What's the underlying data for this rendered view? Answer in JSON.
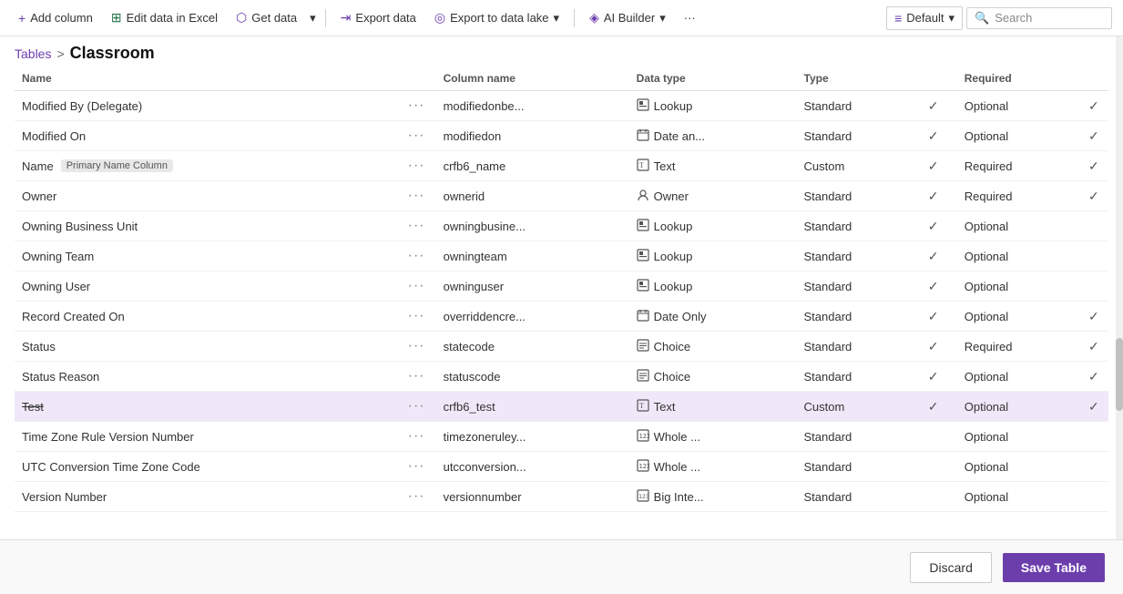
{
  "toolbar": {
    "add_column_label": "Add column",
    "edit_excel_label": "Edit data in Excel",
    "get_data_label": "Get data",
    "export_data_label": "Export data",
    "export_lake_label": "Export to data lake",
    "ai_builder_label": "AI Builder",
    "more_label": "···",
    "default_label": "Default",
    "search_label": "Search"
  },
  "breadcrumb": {
    "parent": "Tables",
    "separator": ">",
    "current": "Classroom"
  },
  "table": {
    "columns": [
      "Name",
      "",
      "Column name",
      "Data type",
      "Type",
      "",
      "Required",
      ""
    ],
    "rows": [
      {
        "name": "Modified By (Delegate)",
        "badge": null,
        "colname": "modifiedonbe...",
        "datatype_icon": "lookup",
        "datatype": "Lookup",
        "coltype": "Standard",
        "searchable": true,
        "required": "Optional",
        "checked": true,
        "strikethrough": false,
        "selected": false
      },
      {
        "name": "Modified On",
        "badge": null,
        "colname": "modifiedon",
        "datatype_icon": "date",
        "datatype": "Date an...",
        "coltype": "Standard",
        "searchable": true,
        "required": "Optional",
        "checked": true,
        "strikethrough": false,
        "selected": false
      },
      {
        "name": "Name",
        "badge": "Primary Name Column",
        "colname": "crfb6_name",
        "datatype_icon": "text",
        "datatype": "Text",
        "coltype": "Custom",
        "searchable": true,
        "required": "Required",
        "checked": true,
        "strikethrough": false,
        "selected": false
      },
      {
        "name": "Owner",
        "badge": null,
        "colname": "ownerid",
        "datatype_icon": "owner",
        "datatype": "Owner",
        "coltype": "Standard",
        "searchable": true,
        "required": "Required",
        "checked": true,
        "strikethrough": false,
        "selected": false
      },
      {
        "name": "Owning Business Unit",
        "badge": null,
        "colname": "owningbusine...",
        "datatype_icon": "lookup",
        "datatype": "Lookup",
        "coltype": "Standard",
        "searchable": true,
        "required": "Optional",
        "checked": false,
        "strikethrough": false,
        "selected": false
      },
      {
        "name": "Owning Team",
        "badge": null,
        "colname": "owningteam",
        "datatype_icon": "lookup",
        "datatype": "Lookup",
        "coltype": "Standard",
        "searchable": true,
        "required": "Optional",
        "checked": false,
        "strikethrough": false,
        "selected": false
      },
      {
        "name": "Owning User",
        "badge": null,
        "colname": "owninguser",
        "datatype_icon": "lookup",
        "datatype": "Lookup",
        "coltype": "Standard",
        "searchable": true,
        "required": "Optional",
        "checked": false,
        "strikethrough": false,
        "selected": false
      },
      {
        "name": "Record Created On",
        "badge": null,
        "colname": "overriddencre...",
        "datatype_icon": "date",
        "datatype": "Date Only",
        "coltype": "Standard",
        "searchable": true,
        "required": "Optional",
        "checked": true,
        "strikethrough": false,
        "selected": false
      },
      {
        "name": "Status",
        "badge": null,
        "colname": "statecode",
        "datatype_icon": "choice",
        "datatype": "Choice",
        "coltype": "Standard",
        "searchable": true,
        "required": "Required",
        "checked": true,
        "strikethrough": false,
        "selected": false
      },
      {
        "name": "Status Reason",
        "badge": null,
        "colname": "statuscode",
        "datatype_icon": "choice",
        "datatype": "Choice",
        "coltype": "Standard",
        "searchable": true,
        "required": "Optional",
        "checked": true,
        "strikethrough": false,
        "selected": false
      },
      {
        "name": "Test",
        "badge": null,
        "colname": "crfb6_test",
        "datatype_icon": "text",
        "datatype": "Text",
        "coltype": "Custom",
        "searchable": true,
        "required": "Optional",
        "checked": true,
        "strikethrough": true,
        "selected": true
      },
      {
        "name": "Time Zone Rule Version Number",
        "badge": null,
        "colname": "timezoneruley...",
        "datatype_icon": "whole",
        "datatype": "Whole ...",
        "coltype": "Standard",
        "searchable": false,
        "required": "Optional",
        "checked": false,
        "strikethrough": false,
        "selected": false
      },
      {
        "name": "UTC Conversion Time Zone Code",
        "badge": null,
        "colname": "utcconversion...",
        "datatype_icon": "whole",
        "datatype": "Whole ...",
        "coltype": "Standard",
        "searchable": false,
        "required": "Optional",
        "checked": false,
        "strikethrough": false,
        "selected": false
      },
      {
        "name": "Version Number",
        "badge": null,
        "colname": "versionnumber",
        "datatype_icon": "bigint",
        "datatype": "Big Inte...",
        "coltype": "Standard",
        "searchable": false,
        "required": "Optional",
        "checked": false,
        "strikethrough": false,
        "selected": false
      }
    ]
  },
  "footer": {
    "discard_label": "Discard",
    "save_label": "Save Table"
  },
  "icons": {
    "plus": "+",
    "excel": "⊞",
    "data": "🗄",
    "export": "⇥",
    "lake": "◎",
    "ai": "◈",
    "filter": "≡",
    "chevron_down": "▾",
    "search": "🔍",
    "lookup": "⊞",
    "text": "⊟",
    "date": "📅",
    "owner": "👤",
    "choice": "☰",
    "whole": "⊟",
    "bigint": "⊟"
  }
}
